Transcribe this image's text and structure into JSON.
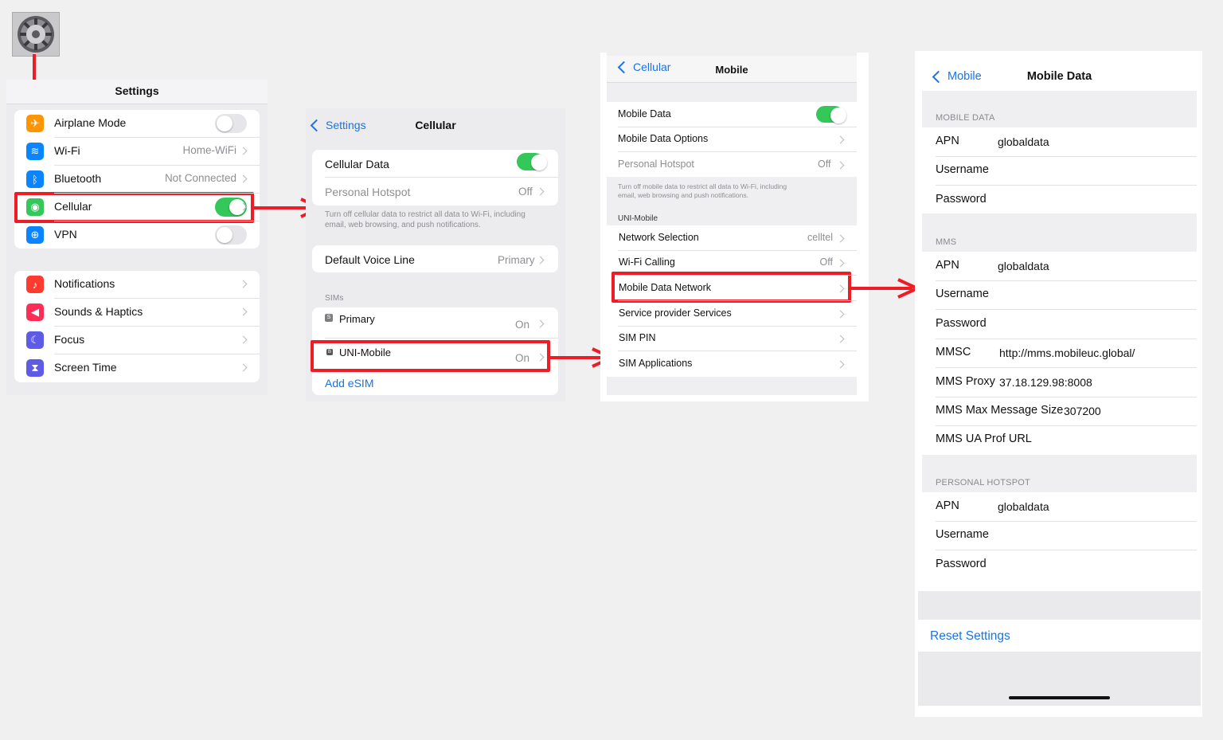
{
  "colors": {
    "accent": "#1a73e8",
    "toggle_on": "#34c759",
    "highlight": "#ee1c25"
  },
  "settings_panel": {
    "title": "Settings",
    "group1": [
      {
        "label": "Airplane Mode",
        "icon": "airplane-icon",
        "color": "#ff9500",
        "toggle": "off"
      },
      {
        "label": "Wi-Fi",
        "icon": "wifi-icon",
        "color": "#0a84ff",
        "value": "Home-WiFi"
      },
      {
        "label": "Bluetooth",
        "icon": "bluetooth-icon",
        "color": "#0a84ff",
        "value": "Not Connected"
      },
      {
        "label": "Cellular",
        "icon": "antenna-icon",
        "color": "#34c759",
        "toggle": "on"
      },
      {
        "label": "VPN",
        "icon": "globe-icon",
        "color": "#0a84ff",
        "toggle": "off"
      }
    ],
    "group2": [
      {
        "label": "Notifications",
        "icon": "bell-icon",
        "color": "#ff3b30"
      },
      {
        "label": "Sounds & Haptics",
        "icon": "speaker-icon",
        "color": "#ff2d55"
      },
      {
        "label": "Focus",
        "icon": "moon-icon",
        "color": "#5e5ce6"
      },
      {
        "label": "Screen Time",
        "icon": "hourglass-icon",
        "color": "#5e5ce6"
      }
    ]
  },
  "cellular_panel": {
    "back": "Settings",
    "title": "Cellular",
    "cellular_data": "Cellular Data",
    "personal_hotspot": "Personal Hotspot",
    "personal_hotspot_value": "Off",
    "footnote_1": "Turn off cellular data to restrict all data to Wi-Fi, including",
    "footnote_2": "email, web browsing, and push notifications.",
    "default_voice": "Default Voice Line",
    "default_voice_value": "Primary",
    "sims_header": "SIMs",
    "sim_primary": "Primary",
    "sim_primary_badge": "S",
    "sim_primary_value": "On",
    "sim_uni": "UNI-Mobile",
    "sim_uni_badge": "B",
    "sim_uni_value": "On",
    "add_esim": "Add eSIM"
  },
  "mobile_panel": {
    "back": "Cellular",
    "title": "Mobile",
    "mobile_data": "Mobile Data",
    "mobile_data_options": "Mobile Data Options",
    "personal_hotspot": "Personal Hotspot",
    "personal_hotspot_value": "Off",
    "footnote_1": "Turn off mobile data to restrict all data to Wi-Fi, including",
    "footnote_2": "email, web browsing and push notifications.",
    "section": "UNI-Mobile",
    "network_selection": "Network Selection",
    "network_selection_value": "celltel",
    "wifi_calling": "Wi-Fi Calling",
    "wifi_calling_value": "Off",
    "mobile_data_network": "Mobile Data Network",
    "service_provider": "Service provider Services",
    "sim_pin": "SIM PIN",
    "sim_applications": "SIM Applications"
  },
  "mobile_data_panel": {
    "back": "Mobile",
    "title": "Mobile Data",
    "section_mobile_data": "MOBILE DATA",
    "apn_label": "APN",
    "username_label": "Username",
    "password_label": "Password",
    "apn_value": "globaldata",
    "section_mms": "MMS",
    "mms_apn_value": "globaldata",
    "mmsc_label": "MMSC",
    "mmsc_value": "http://mms.mobileuc.global/",
    "mms_proxy_label": "MMS Proxy",
    "mms_proxy_value": "37.18.129.98:8008",
    "mms_max_label": "MMS Max Message Size",
    "mms_max_value": "307200",
    "mms_ua_label": "MMS UA Prof URL",
    "section_hotspot": "PERSONAL HOTSPOT",
    "hotspot_apn_value": "globaldata",
    "reset": "Reset Settings"
  }
}
